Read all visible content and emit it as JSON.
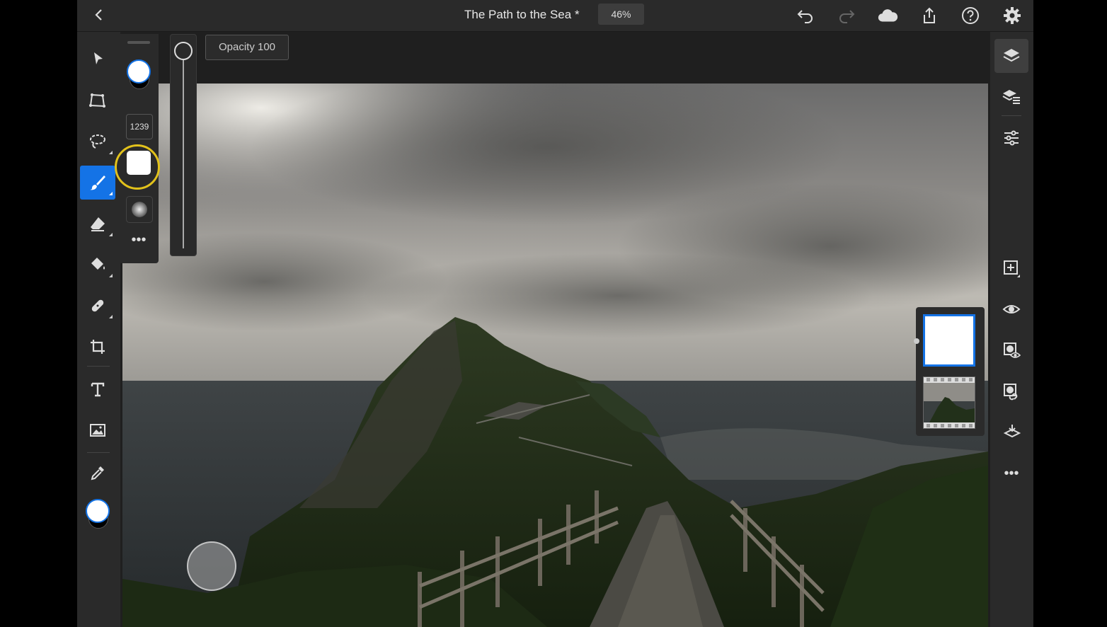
{
  "header": {
    "title": "The Path to the Sea *",
    "zoom": "46%"
  },
  "brush": {
    "size": "1239",
    "more": "•••"
  },
  "opacity_label": "Opacity 100",
  "right_panel": {
    "more": "•••"
  },
  "colors": {
    "accent": "#1473e6",
    "highlight": "#e2c21b",
    "foreground_color": "#ffffff",
    "background_color": "#000000"
  }
}
